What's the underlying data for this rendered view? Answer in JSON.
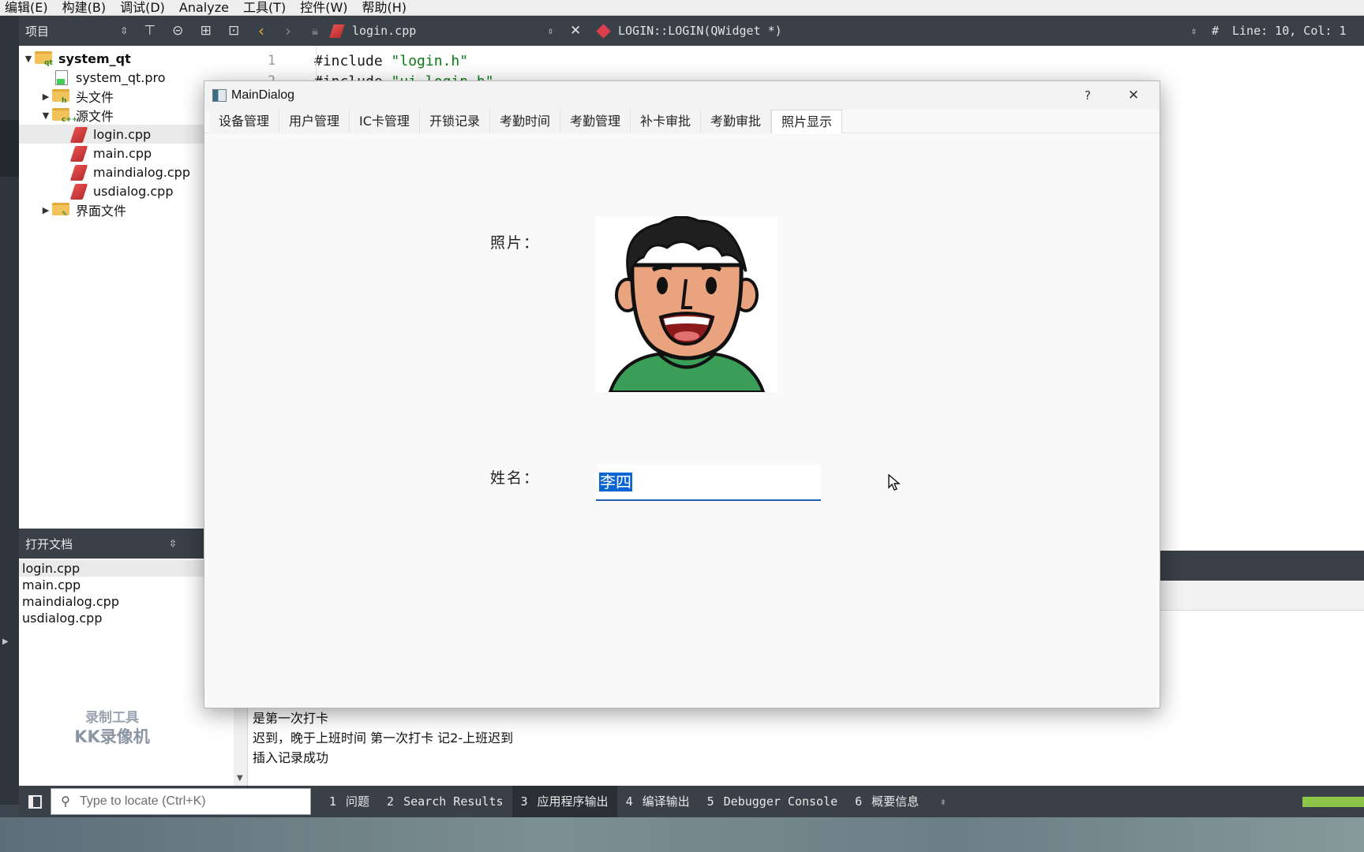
{
  "menu": [
    "编辑(E)",
    "构建(B)",
    "调试(D)",
    "Analyze",
    "工具(T)",
    "控件(W)",
    "帮助(H)"
  ],
  "project_pane": {
    "title": "项目",
    "tree": [
      {
        "label": "system_qt",
        "level": 0,
        "expander": "▼",
        "icon": "qt-project-folder-icon"
      },
      {
        "label": "system_qt.pro",
        "level": 1,
        "expander": "",
        "icon": "pro-file-icon"
      },
      {
        "label": "头文件",
        "level": 1,
        "expander": "▶",
        "icon": "headers-folder-icon"
      },
      {
        "label": "源文件",
        "level": 1,
        "expander": "▼",
        "icon": "sources-folder-icon"
      },
      {
        "label": "login.cpp",
        "level": 2,
        "expander": "",
        "icon": "cpp-file-icon",
        "selected": true
      },
      {
        "label": "main.cpp",
        "level": 2,
        "expander": "",
        "icon": "cpp-file-icon"
      },
      {
        "label": "maindialog.cpp",
        "level": 2,
        "expander": "",
        "icon": "cpp-file-icon"
      },
      {
        "label": "usdialog.cpp",
        "level": 2,
        "expander": "",
        "icon": "cpp-file-icon"
      },
      {
        "label": "界面文件",
        "level": 1,
        "expander": "▶",
        "icon": "forms-folder-icon"
      }
    ]
  },
  "open_docs": {
    "title": "打开文档",
    "items": [
      "login.cpp",
      "main.cpp",
      "maindialog.cpp",
      "usdialog.cpp"
    ]
  },
  "watermark": {
    "line1": "录制工具",
    "line2": "KK录像机"
  },
  "editor": {
    "file": "login.cpp",
    "symbol": "LOGIN::LOGIN(QWidget *)",
    "hash": "#",
    "position": "Line: 10, Col: 1",
    "lines": [
      {
        "num": "1",
        "kw": "#include ",
        "str": "\"login.h\""
      },
      {
        "num": "2",
        "kw": "#include ",
        "str": "\"ui_login.h\""
      }
    ]
  },
  "dialog": {
    "title": "MainDialog",
    "help": "?",
    "close": "✕",
    "tabs": [
      "设备管理",
      "用户管理",
      "IC卡管理",
      "开锁记录",
      "考勤时间",
      "考勤管理",
      "补卡审批",
      "考勤审批",
      "照片显示"
    ],
    "active_tab": 8,
    "photo_label": "照片：",
    "name_label": "姓名：",
    "name_value": "李四"
  },
  "output": {
    "lines": [
      "是第一次打卡",
      "迟到，晚于上班时间 第一次打卡 记2-上班迟到",
      "插入记录成功"
    ]
  },
  "bottom_bar": {
    "locator_placeholder": "Type to locate (Ctrl+K)",
    "tabs": [
      {
        "num": "1",
        "label": "问题"
      },
      {
        "num": "2",
        "label": "Search Results"
      },
      {
        "num": "3",
        "label": "应用程序输出",
        "active": true
      },
      {
        "num": "4",
        "label": "编译输出"
      },
      {
        "num": "5",
        "label": "Debugger Console"
      },
      {
        "num": "6",
        "label": "概要信息"
      }
    ]
  },
  "colors": {
    "accent": "#0a64d4",
    "toolbar": "#3a4048",
    "string": "#0a7a13",
    "progress": "#8dc44a"
  }
}
